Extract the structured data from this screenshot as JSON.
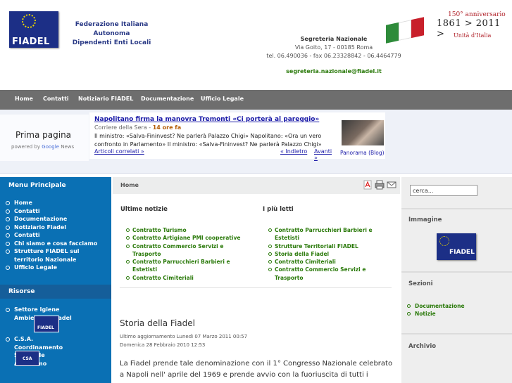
{
  "header": {
    "logo_text": "FIADEL",
    "org_line1": "Federazione Italiana Autonoma",
    "org_line2": "Dipendenti Enti Locali",
    "segreteria_title": "Segreteria Nazionale",
    "address": "Via Goito, 17 - 00185 Roma",
    "phones": "tel. 06.490036 - fax 06.23328842 - 06.4464779",
    "email": "segreteria.nazionale@fiadel.it",
    "anniv_line1": "150° anniversario",
    "anniv_line2": "1861 > 2011 >",
    "anniv_line3": "Unità d'Italia",
    "flag_colors": [
      "#2e8b3a",
      "#ffffff",
      "#c8202b"
    ]
  },
  "nav": {
    "items": [
      "Home",
      "Contatti",
      "Notiziario FIADEL",
      "Documentazione",
      "Ufficio Legale"
    ]
  },
  "news": {
    "widget_title": "Prima pagina",
    "powered_by": "powered by",
    "powered_brand": "Google",
    "powered_suffix": "News",
    "headline": "Napolitano firma la manovra Tremonti «Ci porterà al pareggio»",
    "source": "Corriere della Sera",
    "source_sep": " - ",
    "age": "14 ore fa",
    "summary": "Il ministro: «Salva-Fininvest? Ne parlerà Palazzo Chigi» Napolitano: «Ora un vero confronto in Parlamento» Il ministro: «Salva-Fininvest? Ne parlerà Palazzo Chigi»",
    "related": "Articoli correlati »",
    "prev": "« Indietro",
    "next": "Avanti »",
    "photo_caption": "Panorama (Blog)"
  },
  "left_sidebar": {
    "menu_title": "Menu Principale",
    "menu_items": [
      "Home",
      "Contatti",
      "Documentazione",
      "Notiziario Fiadel",
      "Contatti",
      "Chi siamo e cosa facciamo",
      "Strutture FIADEL sul territorio Nazionale",
      "Ufficio Legale"
    ],
    "resources_title": "Risorse",
    "resource_1": "Settore Igiene Ambientale Fiadel",
    "resource_1_badge": "FIADEL",
    "resource_2": "C.S.A. Coordinamento Sindacale Autonomo",
    "resource_2_badge": "CSA"
  },
  "center": {
    "breadcrumb": "Home",
    "latest_title": "Ultime notizie",
    "latest": [
      "Contratto Turismo",
      "Contratto Artigiane PMI cooperative",
      "Contratto Commercio Servizi e Trasporto",
      "Contratto Parrucchieri Barbieri e Estetisti",
      "Contratto Cimiteriali"
    ],
    "popular_title": "I più letti",
    "popular": [
      "Contratto Parrucchieri Barbieri e Estetisti",
      "Strutture Territoriali FIADEL",
      "Storia della Fiadel",
      "Contratto Cimiteriali",
      "Contratto Commercio Servizi e Trasporto"
    ],
    "article_title": "Storia della Fiadel",
    "updated": "Ultimo aggiornamento Lunedì 07 Marzo 2011 00:57",
    "created": "Domenica 28 Febbraio 2010 12:53",
    "article_body": "La Fiadel prende tale denominazione con il 1° Congresso Nazionale celebrato a Napoli nell' aprile del 1969 e prende avvio con la fuoriuscita di tutti i"
  },
  "right_sidebar": {
    "search_value": "cerca...",
    "image_title": "Immagine",
    "image_badge": "FIADEL",
    "sections_title": "Sezioni",
    "sections": [
      "Documentazione",
      "Notizie"
    ],
    "archive_title": "Archivio"
  }
}
